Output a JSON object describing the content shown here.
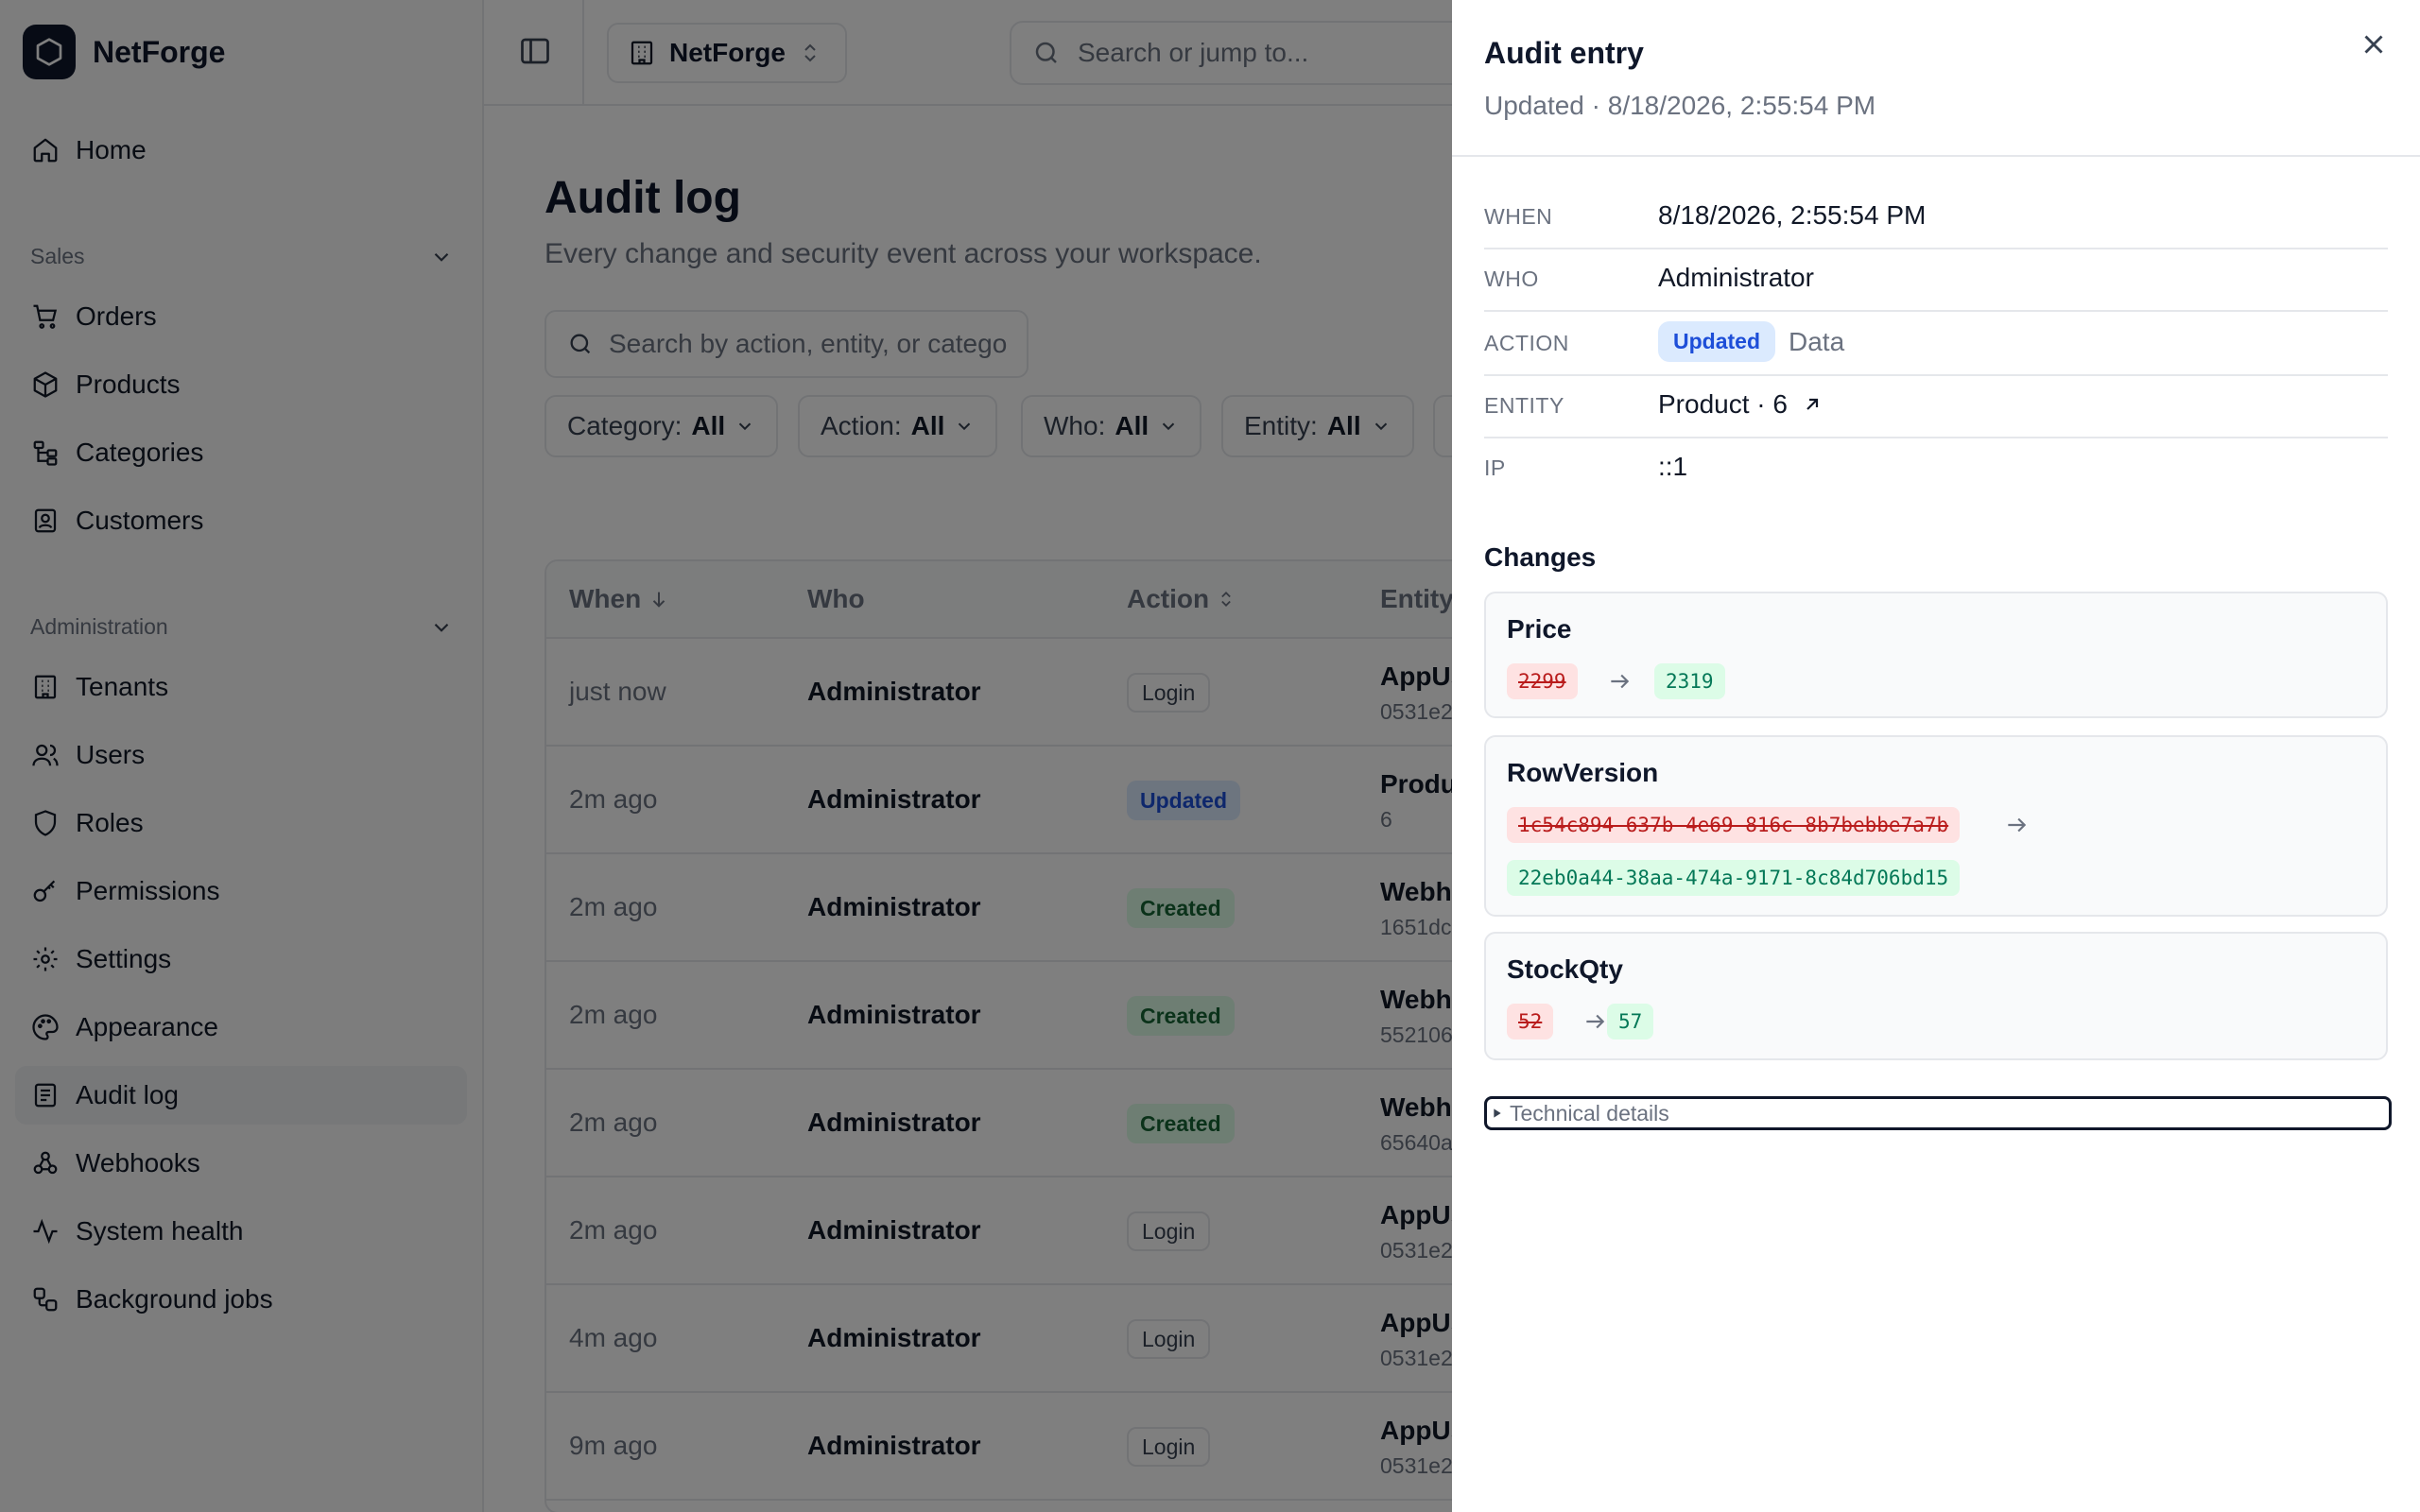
{
  "brand": {
    "name": "NetForge"
  },
  "sidebar": {
    "home": "Home",
    "sales_heading": "Sales",
    "sales_items": [
      "Orders",
      "Products",
      "Categories",
      "Customers"
    ],
    "admin_heading": "Administration",
    "admin_items": [
      "Tenants",
      "Users",
      "Roles",
      "Permissions",
      "Settings",
      "Appearance",
      "Audit log",
      "Webhooks",
      "System health",
      "Background jobs"
    ],
    "active": "Audit log"
  },
  "topbar": {
    "tenant": "NetForge",
    "search_placeholder": "Search or jump to..."
  },
  "page": {
    "title": "Audit log",
    "subtitle": "Every change and security event across your workspace.",
    "search_placeholder": "Search by action, entity, or catego",
    "filters": [
      {
        "label": "Category:",
        "value": "All"
      },
      {
        "label": "Action:",
        "value": "All"
      },
      {
        "label": "Who:",
        "value": "All"
      },
      {
        "label": "Entity:",
        "value": "All"
      }
    ]
  },
  "table": {
    "headers": {
      "when": "When",
      "who": "Who",
      "action": "Action",
      "entity": "Entity"
    },
    "rows": [
      {
        "when": "just now",
        "who": "Administrator",
        "action": "Login",
        "action_type": "login",
        "entity": "AppUs",
        "entity_id": "0531e2"
      },
      {
        "when": "2m ago",
        "who": "Administrator",
        "action": "Updated",
        "action_type": "updated",
        "entity": "Produ",
        "entity_id": "6"
      },
      {
        "when": "2m ago",
        "who": "Administrator",
        "action": "Created",
        "action_type": "created",
        "entity": "Webh",
        "entity_id": "1651dc"
      },
      {
        "when": "2m ago",
        "who": "Administrator",
        "action": "Created",
        "action_type": "created",
        "entity": "Webh",
        "entity_id": "552106"
      },
      {
        "when": "2m ago",
        "who": "Administrator",
        "action": "Created",
        "action_type": "created",
        "entity": "Webh",
        "entity_id": "65640a"
      },
      {
        "when": "2m ago",
        "who": "Administrator",
        "action": "Login",
        "action_type": "login",
        "entity": "AppUs",
        "entity_id": "0531e2"
      },
      {
        "when": "4m ago",
        "who": "Administrator",
        "action": "Login",
        "action_type": "login",
        "entity": "AppUs",
        "entity_id": "0531e2"
      },
      {
        "when": "9m ago",
        "who": "Administrator",
        "action": "Login",
        "action_type": "login",
        "entity": "AppUs",
        "entity_id": "0531e2"
      }
    ]
  },
  "drawer": {
    "title": "Audit entry",
    "subtitle": "Updated · 8/18/2026, 2:55:54 PM",
    "fields": {
      "when_label": "WHEN",
      "when": "8/18/2026, 2:55:54 PM",
      "who_label": "WHO",
      "who": "Administrator",
      "action_label": "ACTION",
      "action": "Updated",
      "action_category": "Data",
      "entity_label": "ENTITY",
      "entity": "Product · 6",
      "ip_label": "IP",
      "ip": "::1"
    },
    "changes_title": "Changes",
    "changes": [
      {
        "field": "Price",
        "old": "2299",
        "new": "2319"
      },
      {
        "field": "RowVersion",
        "old": "1c54c894-637b-4e69-816c-8b7bebbe7a7b",
        "new": "22eb0a44-38aa-474a-9171-8c84d706bd15"
      },
      {
        "field": "StockQty",
        "old": "52",
        "new": "57"
      }
    ],
    "technical_details": "Technical details"
  },
  "icons": {
    "brand": "hexagon-icon",
    "home": "home-icon",
    "orders": "cart-icon",
    "products": "box-icon",
    "categories": "tree-icon",
    "customers": "contact-icon",
    "tenants": "building-icon",
    "users": "users-icon",
    "roles": "shield-icon",
    "permissions": "key-icon",
    "settings": "gear-icon",
    "appearance": "palette-icon",
    "audit": "list-icon",
    "webhooks": "webhook-icon",
    "health": "activity-icon",
    "jobs": "jobs-icon"
  }
}
